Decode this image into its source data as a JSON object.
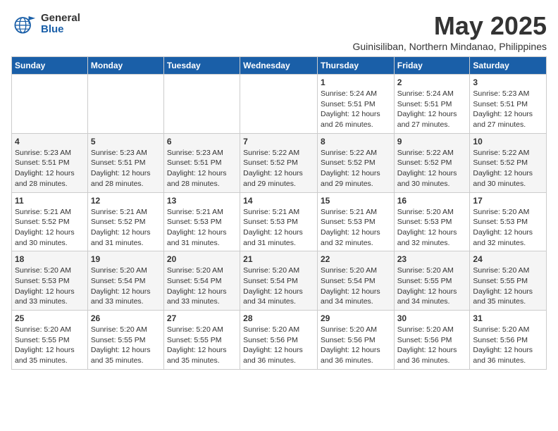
{
  "logo": {
    "general": "General",
    "blue": "Blue"
  },
  "title": "May 2025",
  "subtitle": "Guinisiliban, Northern Mindanao, Philippines",
  "days_of_week": [
    "Sunday",
    "Monday",
    "Tuesday",
    "Wednesday",
    "Thursday",
    "Friday",
    "Saturday"
  ],
  "weeks": [
    [
      {
        "day": "",
        "info": ""
      },
      {
        "day": "",
        "info": ""
      },
      {
        "day": "",
        "info": ""
      },
      {
        "day": "",
        "info": ""
      },
      {
        "day": "1",
        "info": "Sunrise: 5:24 AM\nSunset: 5:51 PM\nDaylight: 12 hours and 26 minutes."
      },
      {
        "day": "2",
        "info": "Sunrise: 5:24 AM\nSunset: 5:51 PM\nDaylight: 12 hours and 27 minutes."
      },
      {
        "day": "3",
        "info": "Sunrise: 5:23 AM\nSunset: 5:51 PM\nDaylight: 12 hours and 27 minutes."
      }
    ],
    [
      {
        "day": "4",
        "info": "Sunrise: 5:23 AM\nSunset: 5:51 PM\nDaylight: 12 hours and 28 minutes."
      },
      {
        "day": "5",
        "info": "Sunrise: 5:23 AM\nSunset: 5:51 PM\nDaylight: 12 hours and 28 minutes."
      },
      {
        "day": "6",
        "info": "Sunrise: 5:23 AM\nSunset: 5:51 PM\nDaylight: 12 hours and 28 minutes."
      },
      {
        "day": "7",
        "info": "Sunrise: 5:22 AM\nSunset: 5:52 PM\nDaylight: 12 hours and 29 minutes."
      },
      {
        "day": "8",
        "info": "Sunrise: 5:22 AM\nSunset: 5:52 PM\nDaylight: 12 hours and 29 minutes."
      },
      {
        "day": "9",
        "info": "Sunrise: 5:22 AM\nSunset: 5:52 PM\nDaylight: 12 hours and 30 minutes."
      },
      {
        "day": "10",
        "info": "Sunrise: 5:22 AM\nSunset: 5:52 PM\nDaylight: 12 hours and 30 minutes."
      }
    ],
    [
      {
        "day": "11",
        "info": "Sunrise: 5:21 AM\nSunset: 5:52 PM\nDaylight: 12 hours and 30 minutes."
      },
      {
        "day": "12",
        "info": "Sunrise: 5:21 AM\nSunset: 5:52 PM\nDaylight: 12 hours and 31 minutes."
      },
      {
        "day": "13",
        "info": "Sunrise: 5:21 AM\nSunset: 5:53 PM\nDaylight: 12 hours and 31 minutes."
      },
      {
        "day": "14",
        "info": "Sunrise: 5:21 AM\nSunset: 5:53 PM\nDaylight: 12 hours and 31 minutes."
      },
      {
        "day": "15",
        "info": "Sunrise: 5:21 AM\nSunset: 5:53 PM\nDaylight: 12 hours and 32 minutes."
      },
      {
        "day": "16",
        "info": "Sunrise: 5:20 AM\nSunset: 5:53 PM\nDaylight: 12 hours and 32 minutes."
      },
      {
        "day": "17",
        "info": "Sunrise: 5:20 AM\nSunset: 5:53 PM\nDaylight: 12 hours and 32 minutes."
      }
    ],
    [
      {
        "day": "18",
        "info": "Sunrise: 5:20 AM\nSunset: 5:53 PM\nDaylight: 12 hours and 33 minutes."
      },
      {
        "day": "19",
        "info": "Sunrise: 5:20 AM\nSunset: 5:54 PM\nDaylight: 12 hours and 33 minutes."
      },
      {
        "day": "20",
        "info": "Sunrise: 5:20 AM\nSunset: 5:54 PM\nDaylight: 12 hours and 33 minutes."
      },
      {
        "day": "21",
        "info": "Sunrise: 5:20 AM\nSunset: 5:54 PM\nDaylight: 12 hours and 34 minutes."
      },
      {
        "day": "22",
        "info": "Sunrise: 5:20 AM\nSunset: 5:54 PM\nDaylight: 12 hours and 34 minutes."
      },
      {
        "day": "23",
        "info": "Sunrise: 5:20 AM\nSunset: 5:55 PM\nDaylight: 12 hours and 34 minutes."
      },
      {
        "day": "24",
        "info": "Sunrise: 5:20 AM\nSunset: 5:55 PM\nDaylight: 12 hours and 35 minutes."
      }
    ],
    [
      {
        "day": "25",
        "info": "Sunrise: 5:20 AM\nSunset: 5:55 PM\nDaylight: 12 hours and 35 minutes."
      },
      {
        "day": "26",
        "info": "Sunrise: 5:20 AM\nSunset: 5:55 PM\nDaylight: 12 hours and 35 minutes."
      },
      {
        "day": "27",
        "info": "Sunrise: 5:20 AM\nSunset: 5:55 PM\nDaylight: 12 hours and 35 minutes."
      },
      {
        "day": "28",
        "info": "Sunrise: 5:20 AM\nSunset: 5:56 PM\nDaylight: 12 hours and 36 minutes."
      },
      {
        "day": "29",
        "info": "Sunrise: 5:20 AM\nSunset: 5:56 PM\nDaylight: 12 hours and 36 minutes."
      },
      {
        "day": "30",
        "info": "Sunrise: 5:20 AM\nSunset: 5:56 PM\nDaylight: 12 hours and 36 minutes."
      },
      {
        "day": "31",
        "info": "Sunrise: 5:20 AM\nSunset: 5:56 PM\nDaylight: 12 hours and 36 minutes."
      }
    ]
  ]
}
